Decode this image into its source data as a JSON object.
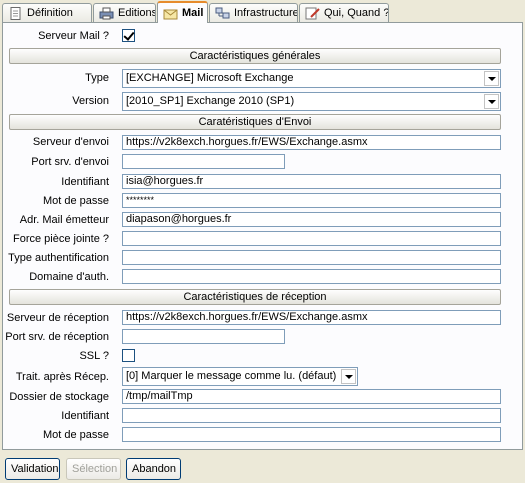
{
  "tabs": [
    {
      "label": "Définition",
      "icon": "document-icon"
    },
    {
      "label": "Editions",
      "icon": "printer-icon"
    },
    {
      "label": "Mail",
      "icon": "envelope-icon"
    },
    {
      "label": "Infrastructure",
      "icon": "network-icon"
    },
    {
      "label": "Qui, Quand ?",
      "icon": "edit-icon"
    }
  ],
  "form": {
    "mail_server_label": "Serveur Mail ?",
    "mail_server_checked": true,
    "general": {
      "header": "Caractéristiques générales",
      "type_label": "Type",
      "type_value": "[EXCHANGE] Microsoft Exchange",
      "version_label": "Version",
      "version_value": "[2010_SP1] Exchange 2010 (SP1)"
    },
    "send": {
      "header": "Caratéristiques d'Envoi",
      "server_label": "Serveur d'envoi",
      "server_value": "https://v2k8exch.horgues.fr/EWS/Exchange.asmx",
      "port_label": "Port srv. d'envoi",
      "port_value": "",
      "id_label": "Identifiant",
      "id_value": "isia@horgues.fr",
      "password_label": "Mot de passe",
      "password_value": "********",
      "sender_label": "Adr. Mail émetteur",
      "sender_value": "diapason@horgues.fr",
      "attach_label": "Force pièce jointe ?",
      "attach_value": "",
      "auth_type_label": "Type authentification",
      "auth_type_value": "",
      "auth_domain_label": "Domaine d'auth.",
      "auth_domain_value": ""
    },
    "receive": {
      "header": "Caractéristiques de réception",
      "server_label": "Serveur de réception",
      "server_value": "https://v2k8exch.horgues.fr/EWS/Exchange.asmx",
      "port_label": "Port srv. de réception",
      "port_value": "",
      "ssl_label": "SSL ?",
      "ssl_checked": false,
      "after_label": "Trait. après Récep.",
      "after_value": "[0] Marquer le message comme lu. (défaut)",
      "folder_label": "Dossier de stockage",
      "folder_value": "/tmp/mailTmp",
      "id_label": "Identifiant",
      "id_value": "",
      "password_label": "Mot de passe",
      "password_value": ""
    }
  },
  "buttons": {
    "validate": "Validation",
    "selection": "Sélection",
    "cancel": "Abandon"
  }
}
